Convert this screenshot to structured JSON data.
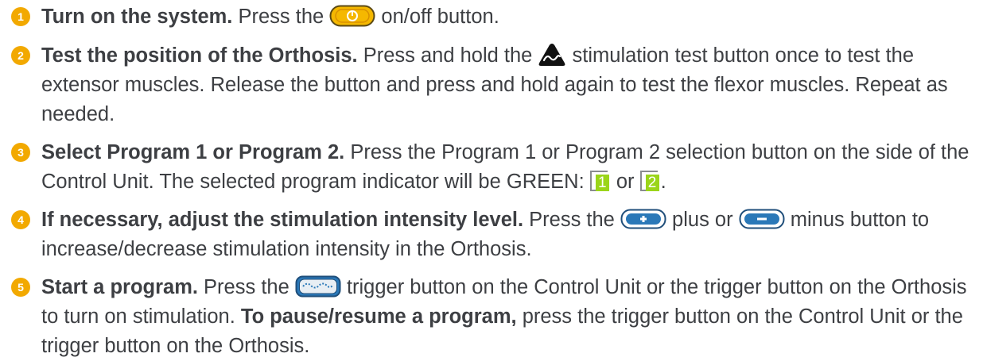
{
  "steps": [
    {
      "number": "1",
      "title": "Turn on the system.",
      "text_a": " Press the ",
      "icon": "on-off-button-icon",
      "text_b": " on/off button."
    },
    {
      "number": "2",
      "title": "Test the position of the Orthosis.",
      "text_a": " Press and hold the ",
      "icon": "stimulation-test-button-icon",
      "text_b": " stimulation test button once to test the extensor muscles. Release the button and press and hold again to test the flexor muscles. Repeat as needed."
    },
    {
      "number": "3",
      "title": "Select Program 1 or Program 2.",
      "text_a": " Press the Program 1 or Program 2 selection button on the side of the Control Unit. The selected program indicator will be GREEN: ",
      "indicator_1": "1",
      "text_or": " or ",
      "indicator_2": "2",
      "text_end": "."
    },
    {
      "number": "4",
      "title": "If necessary, adjust the stimulation intensity level.",
      "text_a": " Press the ",
      "icon_plus": "plus-button-icon",
      "text_b": " plus or ",
      "icon_minus": "minus-button-icon",
      "text_c": " minus button to increase/decrease stimulation intensity in the Orthosis."
    },
    {
      "number": "5",
      "title": "Start a program.",
      "text_a": " Press the ",
      "icon": "trigger-button-icon",
      "text_b": " trigger button on the Control Unit or the trigger button on the Orthosis to turn on stimulation. ",
      "bold_2": "To pause/resume a program,",
      "text_c": " press the trigger button on the Control Unit or the trigger button on the Orthosis."
    }
  ],
  "colors": {
    "number_badge": "#f2a900",
    "text": "#3d3f43",
    "onoff_fill": "#f5b800",
    "button_blue": "#2a78b8",
    "indicator_green": "#9bd51a"
  }
}
